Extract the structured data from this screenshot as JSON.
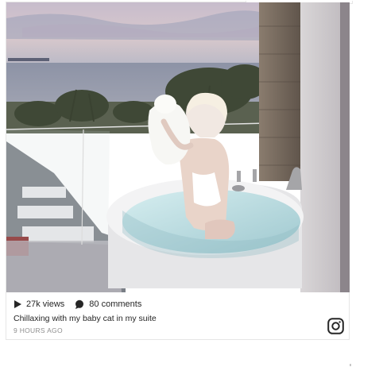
{
  "post": {
    "media": {
      "icon": "photo",
      "accent_colors": {
        "sky_top": "#c9bccb",
        "sea": "#8f98ad",
        "water": "#bfe3e6",
        "tub": "#f2f2f2"
      }
    },
    "stats": {
      "views_icon": "play-icon",
      "views_label": "27k views",
      "comments_icon": "comment-icon",
      "comments_label": "80 comments"
    },
    "caption": "Chillaxing with my baby cat in my suite",
    "timestamp": "9 HOURS AGO",
    "source_icon": "instagram-icon"
  }
}
